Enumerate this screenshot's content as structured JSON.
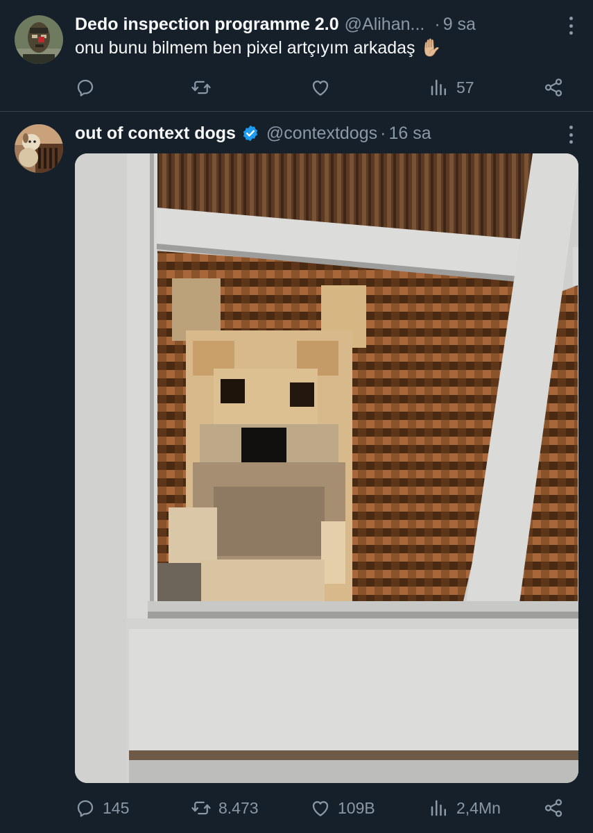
{
  "tweets": [
    {
      "display_name": "Dedo inspection programme 2.0",
      "handle": "@Alihan...",
      "separator": "·",
      "time": "9 sa",
      "text": "onu bunu bilmem ben pixel artçıyım arkadaş ✋🏼",
      "verified": false,
      "stats": {
        "replies": "",
        "retweets": "",
        "likes": "",
        "views": "57"
      }
    },
    {
      "display_name": "out of context dogs",
      "handle": "@contextdogs",
      "separator": "·",
      "time": "16 sa",
      "verified": true,
      "stats": {
        "replies": "145",
        "retweets": "8.473",
        "likes": "109B",
        "views": "2,4Mn"
      }
    }
  ],
  "icons": {
    "reply": "reply-icon",
    "retweet": "retweet-icon",
    "like": "like-icon",
    "views": "views-icon",
    "share": "share-icon",
    "more": "more-icon",
    "verified": "verified-badge-icon"
  },
  "colors": {
    "background": "#15202b",
    "divider": "#38444d",
    "primary_text": "#f7f9f9",
    "secondary_text": "#8b98a5",
    "verified_blue": "#1d9bf0"
  }
}
